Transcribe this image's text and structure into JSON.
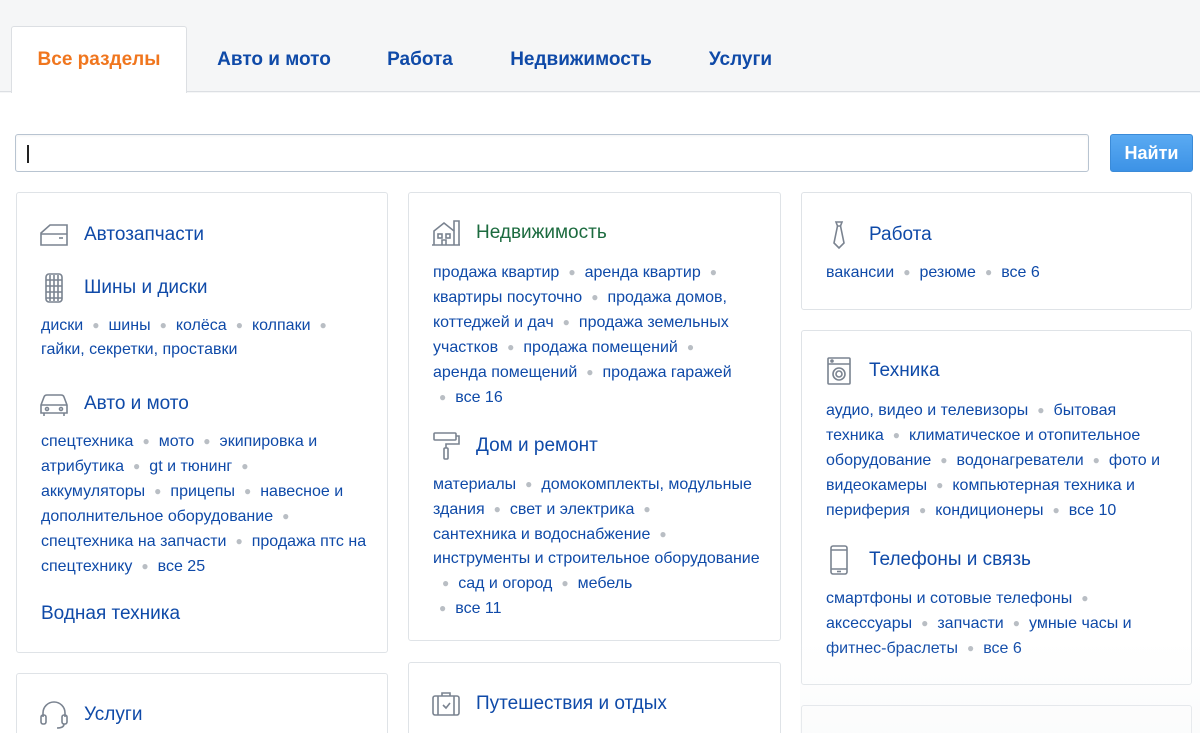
{
  "tabs": [
    {
      "label": "Все разделы",
      "active": true
    },
    {
      "label": "Авто и мото"
    },
    {
      "label": "Работа"
    },
    {
      "label": "Недвижимость"
    },
    {
      "label": "Услуги"
    }
  ],
  "search": {
    "value": "",
    "button_label": "Найти"
  },
  "colors": {
    "accent": "#f0761e",
    "link": "#0f4aa8",
    "realty_title": "#1c6b3f",
    "button": "#3c92e6"
  },
  "categories": {
    "autoparts": {
      "title": "Автозапчасти",
      "icon": "car-door-icon"
    },
    "tires": {
      "title": "Шины и диски",
      "icon": "tire-icon",
      "links": [
        "диски",
        "шины",
        "колёса",
        "колпаки",
        "гайки, секретки, проставки"
      ]
    },
    "auto": {
      "title": "Авто и мото",
      "icon": "car-icon",
      "links": [
        "спецтехника",
        "мото",
        "экипировка и атрибутика",
        "gt и тюнинг",
        "аккумуляторы",
        "прицепы",
        "навесное и дополнительное оборудование",
        "спецтехника на запчасти",
        "продажа птс на спецтехнику",
        "все 25"
      ]
    },
    "water": {
      "title": "Водная техника"
    },
    "services": {
      "title": "Услуги",
      "icon": "headset-icon"
    },
    "realty": {
      "title": "Недвижимость",
      "icon": "house-icon",
      "links": [
        "продажа квартир",
        "аренда квартир",
        "квартиры посуточно",
        "продажа домов, коттеджей и дач",
        "продажа земельных участков",
        "продажа помещений",
        "аренда помещений",
        "продажа гаражей",
        "все 16"
      ]
    },
    "home": {
      "title": "Дом и ремонт",
      "icon": "paint-roller-icon",
      "links": [
        "материалы",
        "домокомплекты, модульные здания",
        "свет и электрика",
        "сантехника и водоснабжение",
        "инструменты и строительное оборудование",
        "сад и огород",
        "мебель",
        "все 11"
      ]
    },
    "travel": {
      "title": "Путешествия и отдых",
      "icon": "suitcase-icon"
    },
    "jobs": {
      "title": "Работа",
      "icon": "tie-icon",
      "links": [
        "вакансии",
        "резюме",
        "все 6"
      ]
    },
    "tech": {
      "title": "Техника",
      "icon": "washing-machine-icon",
      "links": [
        "аудио, видео и телевизоры",
        "бытовая техника",
        "климатическое и отопительное оборудование",
        "водонагреватели",
        "фото и видеокамеры",
        "компьютерная техника и периферия",
        "кондиционеры",
        "все 10"
      ]
    },
    "phones": {
      "title": "Телефоны и связь",
      "icon": "phone-icon",
      "links": [
        "смартфоны и сотовые телефоны",
        "аксессуары",
        "запчасти",
        "умные часы и фитнес-браслеты",
        "все 6"
      ]
    }
  }
}
